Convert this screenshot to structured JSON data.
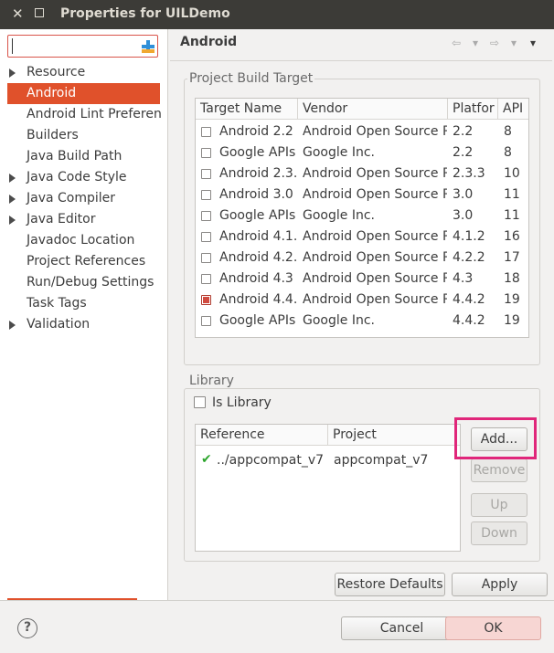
{
  "window": {
    "title": "Properties for UILDemo"
  },
  "filter": {
    "value": "",
    "placeholder": ""
  },
  "tree": [
    {
      "label": "Resource",
      "expandable": true
    },
    {
      "label": "Android",
      "expandable": false,
      "selected": true
    },
    {
      "label": "Android Lint Preferen",
      "expandable": false
    },
    {
      "label": "Builders",
      "expandable": false
    },
    {
      "label": "Java Build Path",
      "expandable": false
    },
    {
      "label": "Java Code Style",
      "expandable": true
    },
    {
      "label": "Java Compiler",
      "expandable": true
    },
    {
      "label": "Java Editor",
      "expandable": true
    },
    {
      "label": "Javadoc Location",
      "expandable": false
    },
    {
      "label": "Project References",
      "expandable": false
    },
    {
      "label": "Run/Debug Settings",
      "expandable": false
    },
    {
      "label": "Task Tags",
      "expandable": false
    },
    {
      "label": "Validation",
      "expandable": true
    }
  ],
  "page": {
    "title": "Android"
  },
  "build_target": {
    "group_label": "Project Build Target",
    "columns": [
      "Target Name",
      "Vendor",
      "Platfor",
      "API"
    ],
    "rows": [
      {
        "name": "Android 2.2",
        "vendor": "Android Open Source Pr",
        "platform": "2.2",
        "api": "8",
        "checked": false
      },
      {
        "name": "Google APIs",
        "vendor": "Google Inc.",
        "platform": "2.2",
        "api": "8",
        "checked": false
      },
      {
        "name": "Android 2.3.:",
        "vendor": "Android Open Source Pr",
        "platform": "2.3.3",
        "api": "10",
        "checked": false
      },
      {
        "name": "Android 3.0",
        "vendor": "Android Open Source Pr",
        "platform": "3.0",
        "api": "11",
        "checked": false
      },
      {
        "name": "Google APIs",
        "vendor": "Google Inc.",
        "platform": "3.0",
        "api": "11",
        "checked": false
      },
      {
        "name": "Android 4.1.:",
        "vendor": "Android Open Source Pr",
        "platform": "4.1.2",
        "api": "16",
        "checked": false
      },
      {
        "name": "Android 4.2.:",
        "vendor": "Android Open Source Pr",
        "platform": "4.2.2",
        "api": "17",
        "checked": false
      },
      {
        "name": "Android 4.3",
        "vendor": "Android Open Source Pr",
        "platform": "4.3",
        "api": "18",
        "checked": false
      },
      {
        "name": "Android 4.4.:",
        "vendor": "Android Open Source Pr",
        "platform": "4.4.2",
        "api": "19",
        "checked": true
      },
      {
        "name": "Google APIs",
        "vendor": "Google Inc.",
        "platform": "4.4.2",
        "api": "19",
        "checked": false
      }
    ]
  },
  "library": {
    "group_label": "Library",
    "is_library_label": "Is Library",
    "is_library_checked": false,
    "columns": [
      "Reference",
      "Project"
    ],
    "rows": [
      {
        "reference": "../appcompat_v7",
        "project": "appcompat_v7",
        "status": "ok"
      }
    ],
    "buttons": {
      "add": "Add...",
      "remove": "Remove",
      "up": "Up",
      "down": "Down"
    }
  },
  "footer": {
    "restore_defaults": "Restore Defaults",
    "apply": "Apply",
    "cancel": "Cancel",
    "ok": "OK",
    "help": "?"
  },
  "colors": {
    "selection": "#e0512b",
    "highlight": "#e0267a",
    "titlebar": "#3c3b37"
  }
}
